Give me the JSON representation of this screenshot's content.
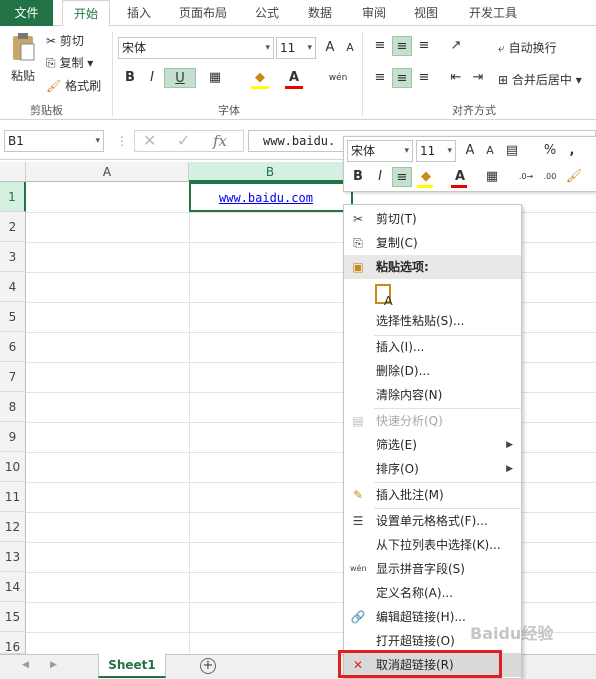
{
  "tabs": [
    "文件",
    "开始",
    "插入",
    "页面布局",
    "公式",
    "数据",
    "审阅",
    "视图",
    "开发工具"
  ],
  "clipboard": {
    "paste": "粘贴",
    "cut": "剪切",
    "copy": "复制",
    "format_painter": "格式刷",
    "group": "剪贴板"
  },
  "font": {
    "name": "宋体",
    "size": "11",
    "bold": "B",
    "italic": "I",
    "underline": "U",
    "group": "字体",
    "grow": "A",
    "shrink": "A"
  },
  "align": {
    "wrap": "自动换行",
    "merge": "合并后居中",
    "group": "对齐方式"
  },
  "formula": {
    "namebox": "B1",
    "fx": "fx",
    "value": "www.baidu."
  },
  "columns": [
    "A",
    "B"
  ],
  "rows": [
    "1",
    "2",
    "3",
    "4",
    "5",
    "6",
    "7",
    "8",
    "9",
    "10",
    "11",
    "12",
    "13",
    "14",
    "15",
    "16"
  ],
  "cell_b1": "www.baidu.com",
  "sheet": {
    "name": "Sheet1",
    "add": "+"
  },
  "mini": {
    "font": "宋体",
    "size": "11",
    "bold": "B",
    "italic": "I",
    "percent": "%",
    "comma": ","
  },
  "menu": {
    "cut": "剪切(T)",
    "copy": "复制(C)",
    "paste_header": "粘贴选项:",
    "paste_special": "选择性粘贴(S)...",
    "insert": "插入(I)...",
    "delete": "删除(D)...",
    "clear": "清除内容(N)",
    "quick": "快速分析(Q)",
    "filter": "筛选(E)",
    "sort": "排序(O)",
    "comment": "插入批注(M)",
    "format": "设置单元格格式(F)...",
    "pick": "从下拉列表中选择(K)...",
    "pinyin": "显示拼音字段(S)",
    "define": "定义名称(A)...",
    "edit_link": "编辑超链接(H)...",
    "open_link": "打开超链接(O)",
    "remove_link": "取消超链接(R)"
  },
  "watermark": "Baidu经验",
  "colors": {
    "excel_green": "#217346",
    "highlight": "#d9d9d9",
    "red_box": "#e02020",
    "link": "#0000ee"
  }
}
